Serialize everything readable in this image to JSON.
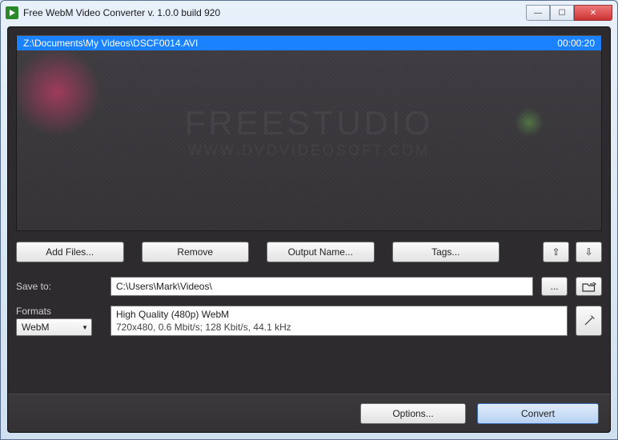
{
  "title": "Free WebM Video Converter  v. 1.0.0 build 920",
  "file": {
    "path": "Z:\\Documents\\My Videos\\DSCF0014.AVI",
    "duration": "00:00:20"
  },
  "watermark": {
    "line1": "FREESTUDIO",
    "line2": "WWW.DVDVIDEOSOFT.COM"
  },
  "buttons": {
    "add": "Add Files...",
    "remove": "Remove",
    "output_name": "Output Name...",
    "tags": "Tags...",
    "up": "⇧",
    "down": "⇩"
  },
  "save": {
    "label": "Save to:",
    "path": "C:\\Users\\Mark\\Videos\\",
    "browse": "...",
    "open": "open-folder"
  },
  "formats": {
    "label": "Formats",
    "value": "WebM",
    "preset_name": "High Quality (480p) WebM",
    "preset_detail": "720x480, 0.6 Mbit/s; 128 Kbit/s, 44.1 kHz"
  },
  "footer": {
    "options": "Options...",
    "convert": "Convert"
  }
}
